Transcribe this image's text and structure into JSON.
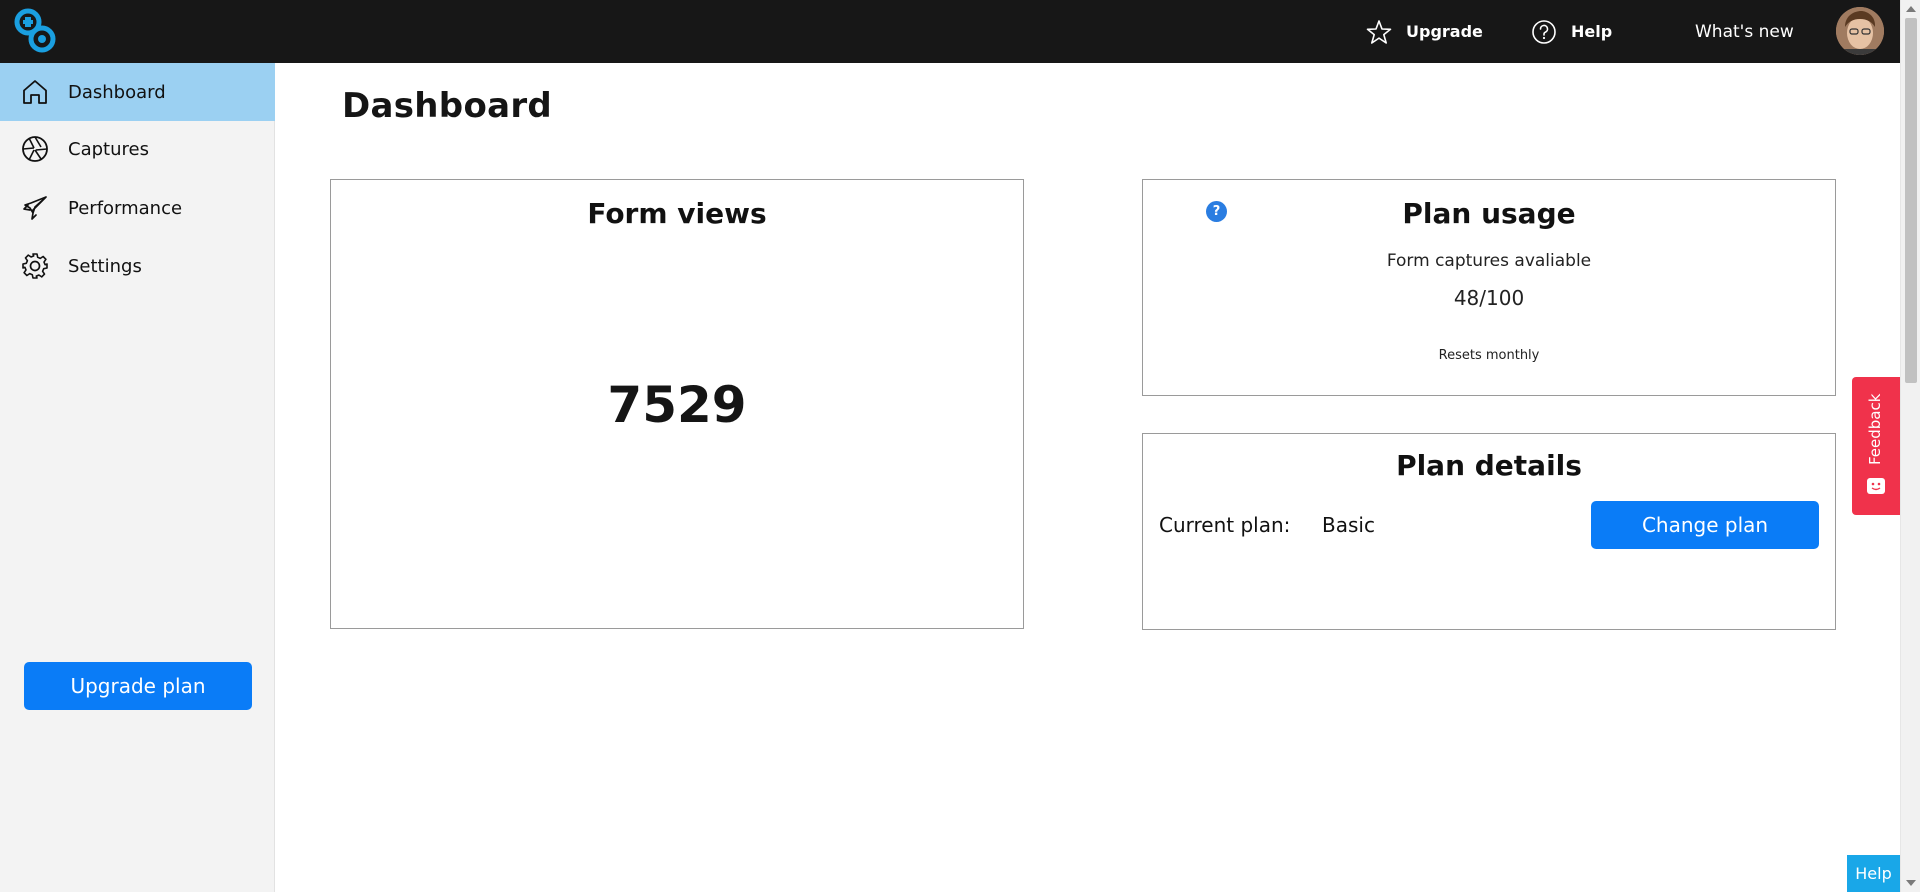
{
  "topbar": {
    "upgrade_label": "Upgrade",
    "help_label": "Help",
    "whats_new_label": "What's new"
  },
  "sidebar": {
    "items": [
      {
        "label": "Dashboard",
        "icon": "home-icon",
        "active": true
      },
      {
        "label": "Captures",
        "icon": "aperture-icon",
        "active": false
      },
      {
        "label": "Performance",
        "icon": "rocket-icon",
        "active": false
      },
      {
        "label": "Settings",
        "icon": "gear-icon",
        "active": false
      }
    ],
    "upgrade_button": "Upgrade plan"
  },
  "main": {
    "title": "Dashboard",
    "form_views": {
      "title": "Form views",
      "value": "7529"
    },
    "plan_usage": {
      "title": "Plan usage",
      "help_icon": "?",
      "label": "Form captures avaliable",
      "value": "48/100",
      "note": "Resets monthly"
    },
    "plan_details": {
      "title": "Plan details",
      "current_label": "Current plan:",
      "current_value": "Basic",
      "change_button": "Change plan"
    }
  },
  "feedback_tab": "Feedback",
  "help_corner": "Help",
  "colors": {
    "topbar": "#171717",
    "accent": "#0a7cf7",
    "active_nav": "#9bd0f2",
    "feedback": "#f0324b",
    "help_corner": "#19a7e8"
  }
}
